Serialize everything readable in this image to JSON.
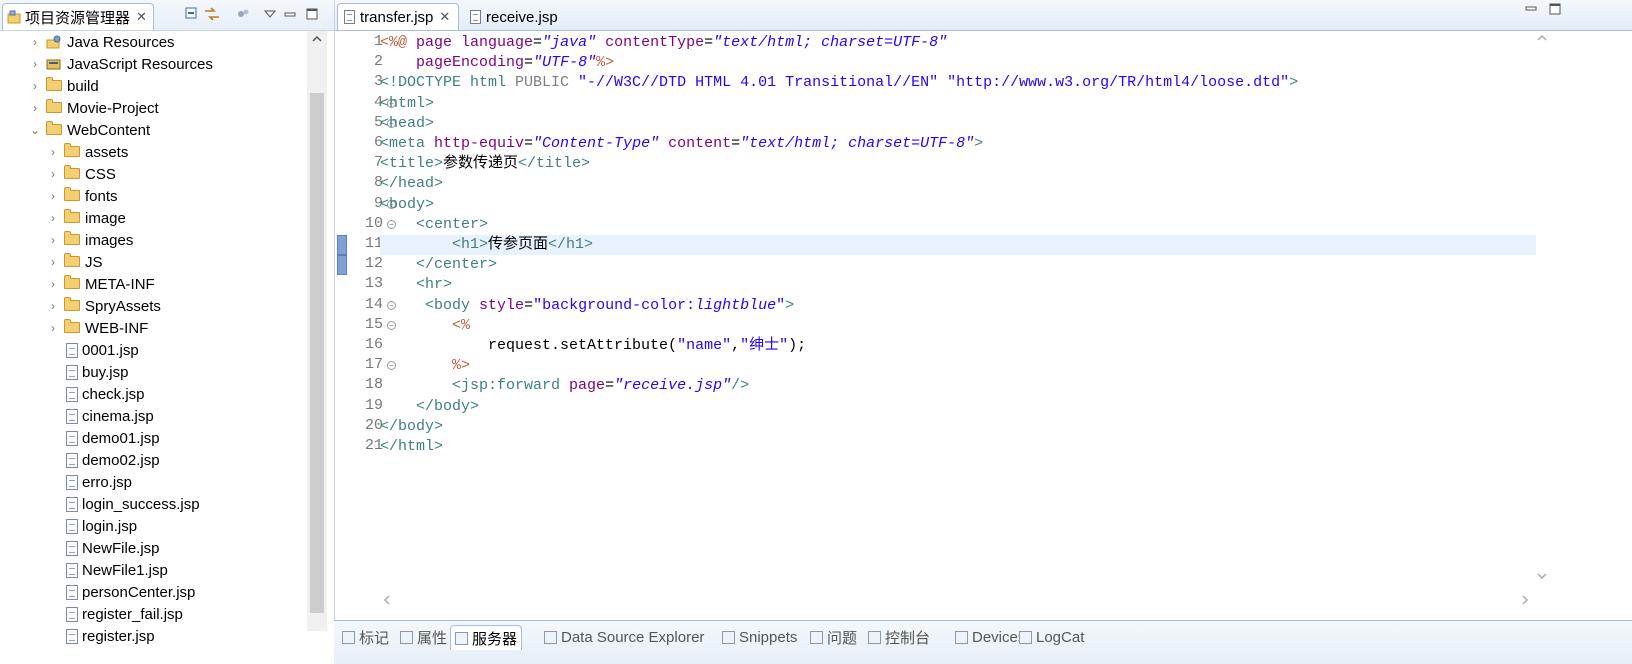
{
  "explorer": {
    "title": "项目资源管理器",
    "close": "✕",
    "items": [
      {
        "label": "Java Resources",
        "kind": "lib",
        "twisty": "›"
      },
      {
        "label": "JavaScript Resources",
        "kind": "lib2",
        "twisty": "›"
      },
      {
        "label": "build",
        "kind": "folder",
        "twisty": "›"
      },
      {
        "label": "Movie-Project",
        "kind": "folder",
        "twisty": "›"
      },
      {
        "label": "WebContent",
        "kind": "folder",
        "twisty": "⌄"
      },
      {
        "label": "assets",
        "kind": "folder",
        "twisty": "›"
      },
      {
        "label": "CSS",
        "kind": "folder",
        "twisty": "›"
      },
      {
        "label": "fonts",
        "kind": "folder",
        "twisty": "›"
      },
      {
        "label": "image",
        "kind": "folder",
        "twisty": "›"
      },
      {
        "label": "images",
        "kind": "folder",
        "twisty": "›"
      },
      {
        "label": "JS",
        "kind": "folder",
        "twisty": "›"
      },
      {
        "label": "META-INF",
        "kind": "folder",
        "twisty": "›"
      },
      {
        "label": "SpryAssets",
        "kind": "folder",
        "twisty": "›"
      },
      {
        "label": "WEB-INF",
        "kind": "folder",
        "twisty": "›"
      },
      {
        "label": "0001.jsp",
        "kind": "file"
      },
      {
        "label": "buy.jsp",
        "kind": "file"
      },
      {
        "label": "check.jsp",
        "kind": "file"
      },
      {
        "label": "cinema.jsp",
        "kind": "file"
      },
      {
        "label": "demo01.jsp",
        "kind": "file"
      },
      {
        "label": "demo02.jsp",
        "kind": "file"
      },
      {
        "label": "erro.jsp",
        "kind": "file"
      },
      {
        "label": "login_success.jsp",
        "kind": "file"
      },
      {
        "label": "login.jsp",
        "kind": "file"
      },
      {
        "label": "NewFile.jsp",
        "kind": "file"
      },
      {
        "label": "NewFile1.jsp",
        "kind": "file"
      },
      {
        "label": "personCenter.jsp",
        "kind": "file"
      },
      {
        "label": "register_fail.jsp",
        "kind": "file"
      },
      {
        "label": "register.jsp",
        "kind": "file"
      }
    ]
  },
  "editor": {
    "tabs": [
      {
        "label": "transfer.jsp",
        "active": true,
        "close": "✕"
      },
      {
        "label": "receive.jsp",
        "active": false
      }
    ],
    "current_line": 11,
    "lines": [
      {
        "n": "1",
        "fold": false,
        "tokens": [
          [
            "jsp",
            "<%@ "
          ],
          [
            "attr",
            "page "
          ],
          [
            "attr",
            "language"
          ],
          [
            "text",
            "="
          ],
          [
            "val",
            "\"java\""
          ],
          [
            "text",
            " "
          ],
          [
            "attr",
            "contentType"
          ],
          [
            "text",
            "="
          ],
          [
            "val",
            "\"text/html; charset=UTF-8\""
          ]
        ]
      },
      {
        "n": "2",
        "fold": false,
        "tokens": [
          [
            "text",
            "    "
          ],
          [
            "attr",
            "pageEncoding"
          ],
          [
            "text",
            "="
          ],
          [
            "val",
            "\"UTF-8\""
          ],
          [
            "jsp",
            "%>"
          ]
        ]
      },
      {
        "n": "3",
        "fold": false,
        "tokens": [
          [
            "tag",
            "<!DOCTYPE html "
          ],
          [
            "grey",
            "PUBLIC "
          ],
          [
            "str",
            "\"-//W3C//DTD HTML 4.01 Transitional//EN\" \"http://www.w3.org/TR/html4/loose.dtd\""
          ],
          [
            "tag",
            ">"
          ]
        ]
      },
      {
        "n": "4",
        "fold": true,
        "tokens": [
          [
            "tag",
            "<html>"
          ]
        ]
      },
      {
        "n": "5",
        "fold": true,
        "tokens": [
          [
            "tag",
            "<head>"
          ]
        ]
      },
      {
        "n": "6",
        "fold": false,
        "tokens": [
          [
            "tag",
            "<meta "
          ],
          [
            "attr",
            "http-equiv"
          ],
          [
            "text",
            "="
          ],
          [
            "val",
            "\"Content-Type\""
          ],
          [
            "text",
            " "
          ],
          [
            "attr",
            "content"
          ],
          [
            "text",
            "="
          ],
          [
            "val",
            "\"text/html; charset=UTF-8\""
          ],
          [
            "tag",
            ">"
          ]
        ]
      },
      {
        "n": "7",
        "fold": false,
        "tokens": [
          [
            "tag",
            "<title>"
          ],
          [
            "text",
            "参数传递页"
          ],
          [
            "tag",
            "</title>"
          ]
        ]
      },
      {
        "n": "8",
        "fold": false,
        "tokens": [
          [
            "tag",
            "</head>"
          ]
        ]
      },
      {
        "n": "9",
        "fold": true,
        "tokens": [
          [
            "tag",
            "<body>"
          ]
        ]
      },
      {
        "n": "10",
        "fold": true,
        "tokens": [
          [
            "text",
            "    "
          ],
          [
            "tag",
            "<center>"
          ]
        ]
      },
      {
        "n": "11",
        "fold": false,
        "tokens": [
          [
            "text",
            "        "
          ],
          [
            "tag",
            "<h1>"
          ],
          [
            "text",
            "传参页面"
          ],
          [
            "tag",
            "</h1>"
          ]
        ]
      },
      {
        "n": "12",
        "fold": false,
        "tokens": [
          [
            "text",
            "    "
          ],
          [
            "tag",
            "</center>"
          ]
        ]
      },
      {
        "n": "13",
        "fold": false,
        "tokens": [
          [
            "text",
            "    "
          ],
          [
            "tag",
            "<hr>"
          ]
        ]
      },
      {
        "n": "14",
        "fold": true,
        "tokens": [
          [
            "text",
            "     "
          ],
          [
            "tag",
            "<body "
          ],
          [
            "attr",
            "style"
          ],
          [
            "text",
            "="
          ],
          [
            "str",
            "\"background-color:"
          ],
          [
            "val",
            "lightblue"
          ],
          [
            "str",
            "\""
          ],
          [
            "tag",
            ">"
          ]
        ]
      },
      {
        "n": "15",
        "fold": true,
        "tokens": [
          [
            "text",
            "        "
          ],
          [
            "jsp",
            "<%"
          ]
        ]
      },
      {
        "n": "16",
        "fold": false,
        "tokens": [
          [
            "text",
            "            "
          ],
          [
            "java",
            "request.setAttribute("
          ],
          [
            "str",
            "\"name\""
          ],
          [
            "java",
            ","
          ],
          [
            "str",
            "\"绅士\""
          ],
          [
            "java",
            ");"
          ]
        ]
      },
      {
        "n": "17",
        "fold": true,
        "tokens": [
          [
            "text",
            "        "
          ],
          [
            "jsp",
            "%>"
          ]
        ]
      },
      {
        "n": "18",
        "fold": false,
        "tokens": [
          [
            "text",
            "        "
          ],
          [
            "tag",
            "<jsp:forward "
          ],
          [
            "attr",
            "page"
          ],
          [
            "text",
            "="
          ],
          [
            "val",
            "\"receive.jsp\""
          ],
          [
            "tag",
            "/>"
          ]
        ]
      },
      {
        "n": "19",
        "fold": false,
        "tokens": [
          [
            "text",
            "    "
          ],
          [
            "tag",
            "</body>"
          ]
        ]
      },
      {
        "n": "20",
        "fold": false,
        "tokens": [
          [
            "tag",
            "</body>"
          ]
        ]
      },
      {
        "n": "21",
        "fold": false,
        "tokens": [
          [
            "tag",
            "</html>"
          ]
        ]
      }
    ]
  },
  "bottom_tabs": [
    {
      "label": "标记",
      "active": false
    },
    {
      "label": "属性",
      "active": false
    },
    {
      "label": "服务器",
      "active": true
    },
    {
      "label": "Data Source Explorer",
      "active": false
    },
    {
      "label": "Snippets",
      "active": false
    },
    {
      "label": "问题",
      "active": false
    },
    {
      "label": "控制台",
      "active": false
    },
    {
      "label": "Devices",
      "active": false
    },
    {
      "label": "LogCat",
      "active": false
    }
  ],
  "colors": {
    "tag": "#3f7f7f",
    "attr": "#7f007f",
    "value": "#2a00ff",
    "jsp": "#bf5f3f",
    "current_line": "#e8f2fe"
  }
}
